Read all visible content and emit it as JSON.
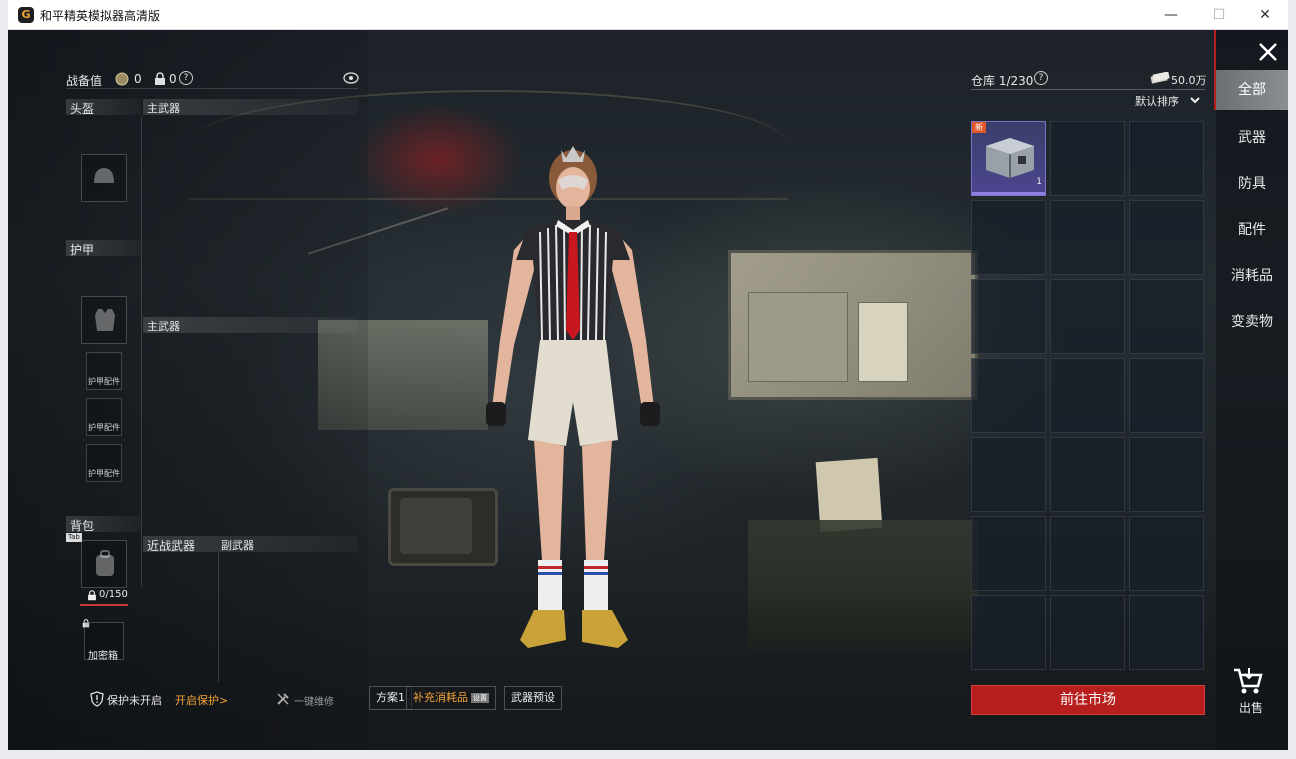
{
  "window": {
    "title": "和平精英模拟器高清版",
    "icon_letter": "G",
    "minimize_glyph": "—",
    "maximize_glyph": "☐",
    "close_glyph": "✕"
  },
  "loadout": {
    "power_label": "战备值",
    "power_value": "0",
    "lock_value": "0",
    "help_glyph": "?",
    "helmet_label": "头盔",
    "primary_label_top": "主武器",
    "armor_label": "护甲",
    "primary_label_mid": "主武器",
    "armor_attach_label": "护甲配件",
    "backpack_label": "背包",
    "tab_key": "Tab",
    "backpack_capacity": "0/150",
    "melee_label": "近战武器",
    "secondary_label": "副武器",
    "safe_box_label": "加密箱"
  },
  "bottom_bar": {
    "protection_status": "保护未开启",
    "enable_protection": "开启保护>",
    "one_click_repair": "一键维修",
    "plan": "方案1",
    "refill": "补充消耗品",
    "refill_tag": "设置",
    "weapon_preset": "武器预设",
    "colors": {
      "accent": "#f2a33a"
    }
  },
  "warehouse": {
    "label": "仓库 1/230",
    "currency": "50.0万",
    "sort": "默认排序",
    "new_badge": "新",
    "first_item_count": "1",
    "go_market": "前往市场",
    "columns": 3,
    "rows": 7
  },
  "categories": {
    "items": [
      "全部",
      "武器",
      "防具",
      "配件",
      "消耗品",
      "变卖物"
    ],
    "active_index": 0
  },
  "sell": {
    "label": "出售"
  },
  "colors": {
    "market_red": "#b71f1f",
    "new_badge": "#e0582a",
    "selected_item": "#5a4fa0"
  }
}
